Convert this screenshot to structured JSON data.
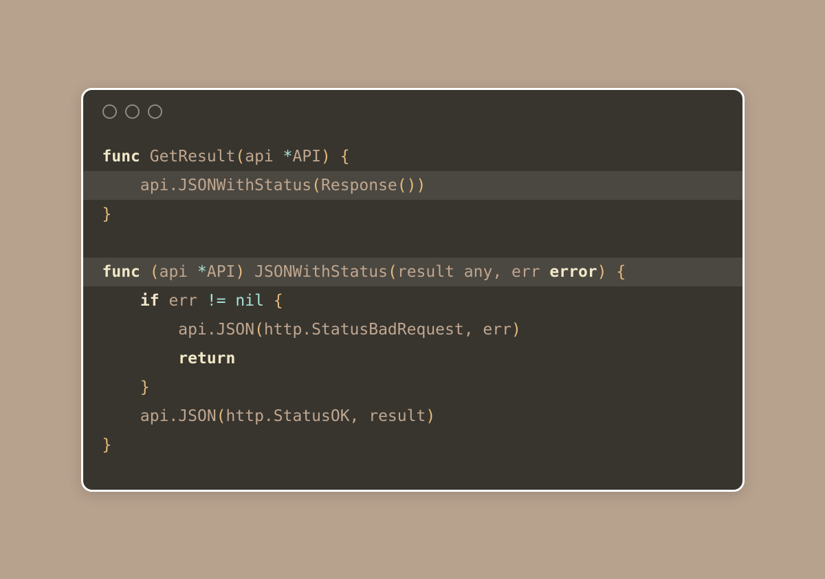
{
  "code": {
    "l1": {
      "func": "func",
      "name": " GetResult",
      "open": "(",
      "param": "api ",
      "star": "*",
      "type": "API",
      "close": ")",
      "sp": " ",
      "brace": "{"
    },
    "l2": {
      "indent": "    ",
      "call": "api.JSONWithStatus",
      "open": "(",
      "inner": "Response",
      "iopen": "(",
      "iclose": ")",
      "close": ")"
    },
    "l3": {
      "brace": "}"
    },
    "l5": {
      "func": "func",
      "sp1": " ",
      "ropen": "(",
      "recv": "api ",
      "star": "*",
      "rtype": "API",
      "rclose": ")",
      "sp2": " ",
      "name": "JSONWithStatus",
      "popen": "(",
      "p1": "result any, err ",
      "errtype": "error",
      "pclose": ")",
      "sp3": " ",
      "brace": "{"
    },
    "l6": {
      "indent": "    ",
      "if": "if",
      "sp1": " ",
      "var": "err ",
      "op": "!=",
      "sp2": " ",
      "nil": "nil",
      "sp3": " ",
      "brace": "{"
    },
    "l7": {
      "indent": "        ",
      "call": "api.JSON",
      "open": "(",
      "args": "http.StatusBadRequest, err",
      "close": ")"
    },
    "l8": {
      "indent": "        ",
      "ret": "return"
    },
    "l9": {
      "indent": "    ",
      "brace": "}"
    },
    "l10": {
      "indent": "    ",
      "call": "api.JSON",
      "open": "(",
      "args": "http.StatusOK, result",
      "close": ")"
    },
    "l11": {
      "brace": "}"
    }
  }
}
